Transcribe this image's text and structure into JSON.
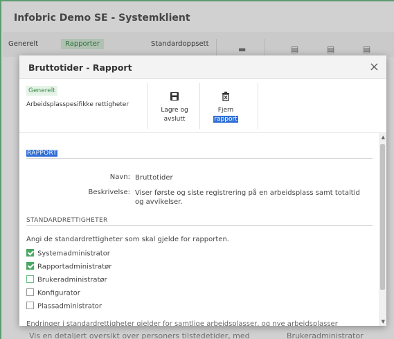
{
  "background": {
    "title": "Infobric Demo SE - Systemklient",
    "tabs": [
      "Generelt",
      "Rapporter",
      "Standardoppsett"
    ],
    "bottom_left": "Vis en detaljert oversikt over personers tilstedetider, med",
    "bottom_right": "Brukeradministrator"
  },
  "modal": {
    "title": "Bruttotider - Rapport",
    "close_glyph": "×",
    "ribbon": {
      "tag": "Generelt",
      "group_label": "Arbeidsplasspesifikke rettigheter",
      "save_line1": "Lagre og",
      "save_line2": "avslutt",
      "remove_line1": "Fjern",
      "remove_line2": "rapport"
    },
    "report_section": "RAPPORT",
    "name_label": "Navn:",
    "name_value": "Bruttotider",
    "desc_label": "Beskrivelse:",
    "desc_value": "Viser første og siste registrering på en arbeidsplass samt totaltid og avvikelser.",
    "std_section": "STANDARDRETTIGHETER",
    "std_intro": "Angi de standardrettigheter som skal gjelde for rapporten.",
    "rights": [
      {
        "label": "Systemadministrator",
        "checked": true
      },
      {
        "label": "Rapportadministratør",
        "checked": true
      },
      {
        "label": "Brukeradministratør",
        "checked": false
      },
      {
        "label": "Konfigurator",
        "checked": false
      },
      {
        "label": "Plassadministrator",
        "checked": false
      }
    ],
    "footer_note": "Endringer i standardrettigheter gjelder for samtlige arbeidsplasser, og nye arbeidsplasser"
  },
  "colors": {
    "accent_green": "#4aa864",
    "highlight_blue": "#2f6fd6"
  }
}
